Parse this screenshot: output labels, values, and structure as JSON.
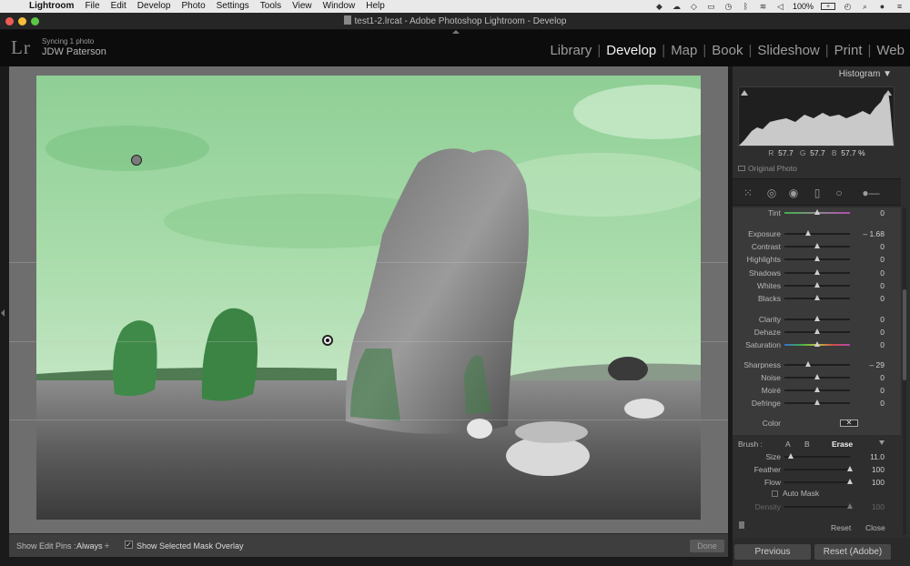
{
  "menubar": {
    "app_name": "Lightroom",
    "items": [
      "File",
      "Edit",
      "Develop",
      "Photo",
      "Settings",
      "Tools",
      "View",
      "Window",
      "Help"
    ],
    "battery": "100%",
    "battery_icon_text": "+"
  },
  "titlebar": {
    "title": "test1-2.lrcat - Adobe Photoshop Lightroom - Develop"
  },
  "identity": {
    "logo": "Lr",
    "sync_status": "Syncing 1 photo",
    "user": "JDW Paterson"
  },
  "modules": [
    "Library",
    "Develop",
    "Map",
    "Book",
    "Slideshow",
    "Print",
    "Web"
  ],
  "active_module": "Develop",
  "toolbar": {
    "show_edit_pins_label": "Show Edit Pins :",
    "show_edit_pins_value": "Always ÷",
    "show_mask_overlay_label": "Show Selected Mask Overlay",
    "show_mask_overlay_checked": "✓",
    "done_label": "Done"
  },
  "histogram": {
    "header": "Histogram",
    "header_arrow": "▼",
    "r_label": "R",
    "r_value": "57.7",
    "g_label": "G",
    "g_value": "57.7",
    "b_label": "B",
    "b_value": "57.7 %",
    "original_photo_label": "Original Photo"
  },
  "tools": [
    "grid-tool",
    "crop-tool",
    "spot-removal-tool",
    "graduated-filter-tool",
    "radial-filter-tool",
    "adjustment-brush-tool"
  ],
  "adjustments": [
    {
      "label": "Tint",
      "value": "0",
      "level": 0.5,
      "track": "tint"
    },
    {
      "label": "Exposure",
      "value": "– 1.68",
      "level": 0.36,
      "track": "plain"
    },
    {
      "label": "Contrast",
      "value": "0",
      "level": 0.5,
      "track": "plain"
    },
    {
      "label": "Highlights",
      "value": "0",
      "level": 0.5,
      "track": "plain"
    },
    {
      "label": "Shadows",
      "value": "0",
      "level": 0.5,
      "track": "plain"
    },
    {
      "label": "Whites",
      "value": "0",
      "level": 0.5,
      "track": "plain"
    },
    {
      "label": "Blacks",
      "value": "0",
      "level": 0.5,
      "track": "plain"
    },
    {
      "label": "Clarity",
      "value": "0",
      "level": 0.5,
      "track": "plain"
    },
    {
      "label": "Dehaze",
      "value": "0",
      "level": 0.5,
      "track": "plain"
    },
    {
      "label": "Saturation",
      "value": "0",
      "level": 0.5,
      "track": "saturation"
    },
    {
      "label": "Sharpness",
      "value": "– 29",
      "level": 0.36,
      "track": "plain"
    },
    {
      "label": "Noise",
      "value": "0",
      "level": 0.5,
      "track": "plain"
    },
    {
      "label": "Moiré",
      "value": "0",
      "level": 0.5,
      "track": "plain"
    },
    {
      "label": "Defringe",
      "value": "0",
      "level": 0.5,
      "track": "plain"
    }
  ],
  "color_label": "Color",
  "color_swatch_text": "✕",
  "brush": {
    "label": "Brush :",
    "tab_a": "A",
    "tab_b": "B",
    "tab_erase": "Erase",
    "size_label": "Size",
    "size_value": "11.0",
    "size_level": 0.1,
    "feather_label": "Feather",
    "feather_value": "100",
    "feather_level": 1.0,
    "flow_label": "Flow",
    "flow_value": "100",
    "flow_level": 1.0,
    "auto_mask_label": "Auto Mask",
    "density_label": "Density",
    "density_value": "100",
    "density_level": 1.0,
    "reset_label": "Reset",
    "close_label": "Close"
  },
  "buttons": {
    "previous": "Previous",
    "reset_adobe": "Reset (Adobe)"
  },
  "colors": {
    "mask_overlay": "#7fd08a",
    "panel_bg": "#3a3a3a",
    "active_module": "#f2f2f2"
  }
}
